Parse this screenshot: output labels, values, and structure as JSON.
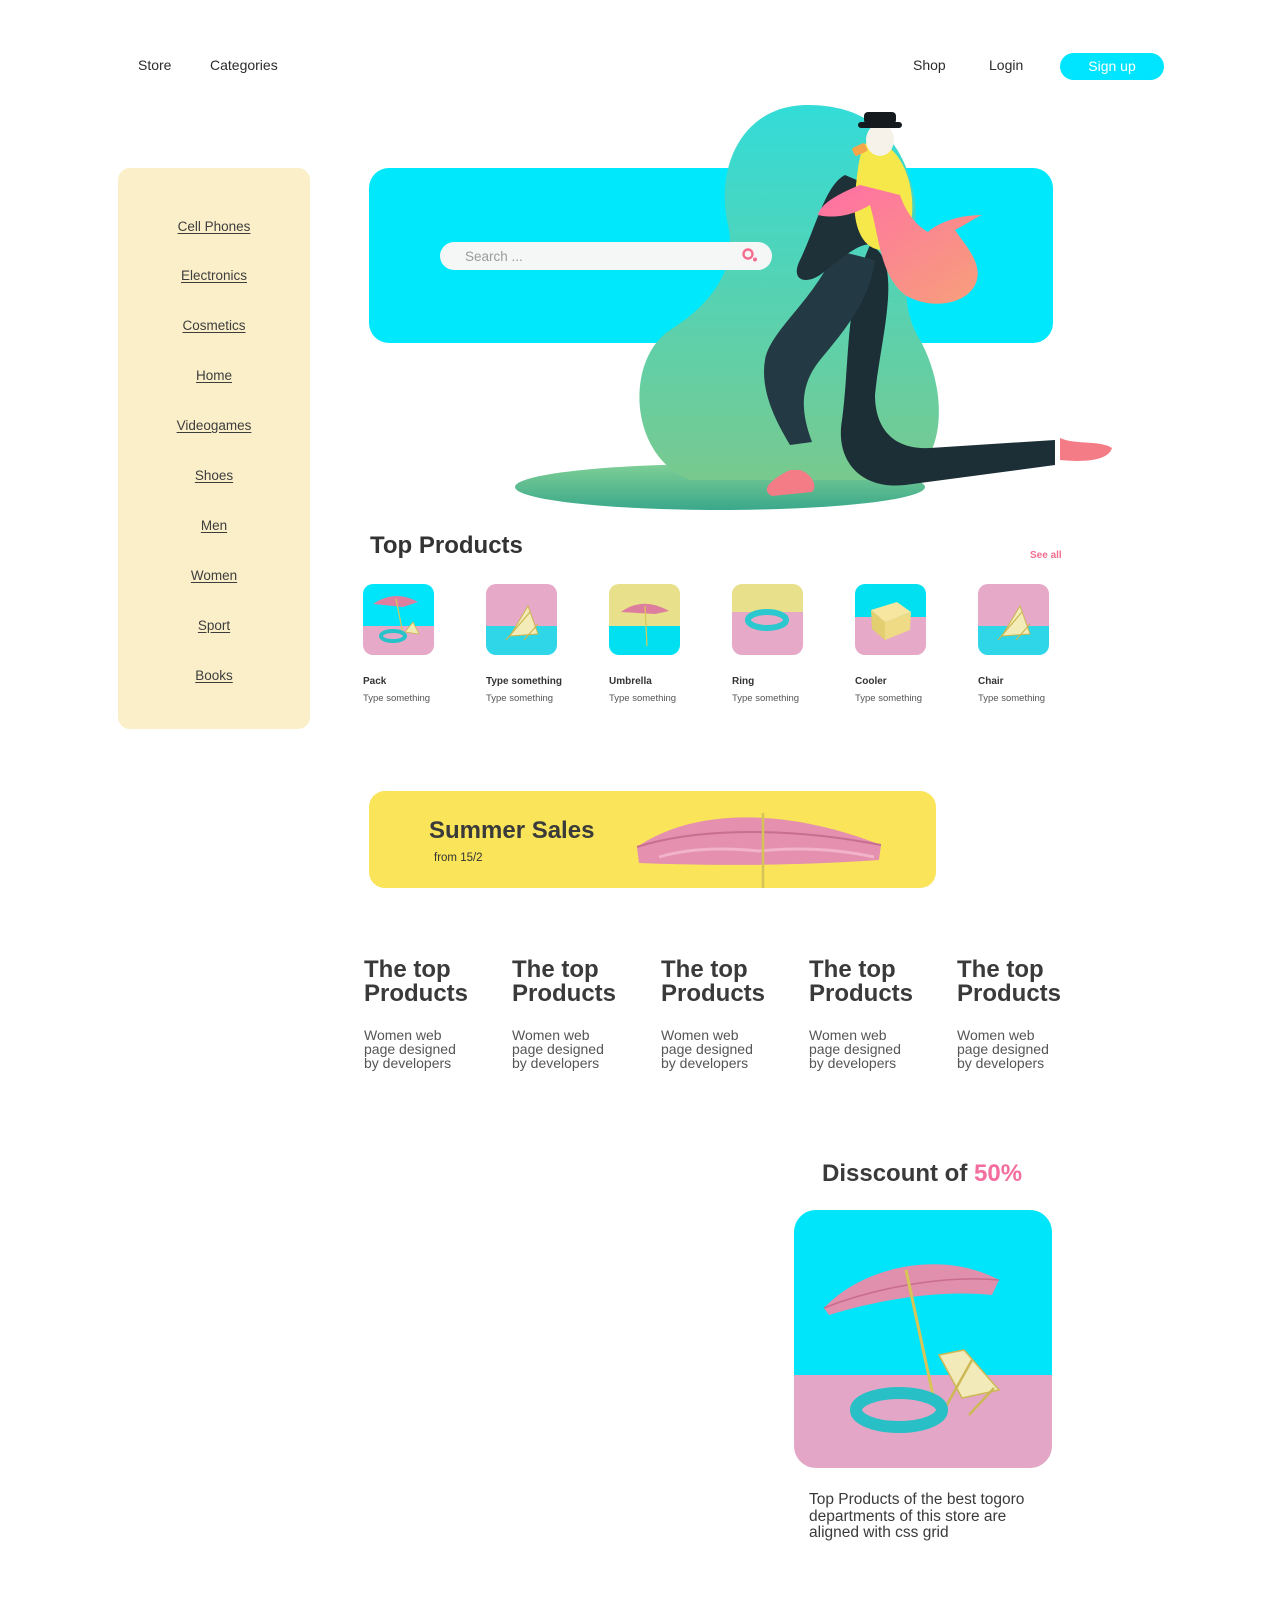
{
  "nav": {
    "store": "Store",
    "categories": "Categories",
    "shop": "Shop",
    "login": "Login",
    "signup": "Sign up"
  },
  "sidebar": {
    "items": [
      {
        "label": "Cell Phones"
      },
      {
        "label": "Electronics"
      },
      {
        "label": "Cosmetics"
      },
      {
        "label": "Home"
      },
      {
        "label": "Videogames"
      },
      {
        "label": "Shoes"
      },
      {
        "label": "Men"
      },
      {
        "label": "Women"
      },
      {
        "label": "Sport"
      },
      {
        "label": "Books"
      }
    ]
  },
  "hero": {
    "search_placeholder": "Search ..."
  },
  "top_products": {
    "title": "Top Products",
    "see_all": "See all",
    "items": [
      {
        "name": "Pack",
        "sub": "Type something"
      },
      {
        "name": "Type something",
        "sub": "Type something"
      },
      {
        "name": "Umbrella",
        "sub": "Type something"
      },
      {
        "name": "Ring",
        "sub": "Type something"
      },
      {
        "name": "Cooler",
        "sub": "Type something"
      },
      {
        "name": "Chair",
        "sub": "Type something"
      }
    ]
  },
  "summer_sales": {
    "title": "Summer Sales",
    "subtitle": "from 15/2"
  },
  "info_columns": [
    {
      "title": "The top Products",
      "text": "Women web page designed by developers"
    },
    {
      "title": "The top Products",
      "text": "Women web page designed by developers"
    },
    {
      "title": "The top Products",
      "text": "Women web page designed by developers"
    },
    {
      "title": "The top Products",
      "text": "Women web page designed by developers"
    },
    {
      "title": "The top Products",
      "text": "Women web page designed by developers"
    }
  ],
  "discount": {
    "title": "Disscount of",
    "percent": "50%",
    "text": "Top Products of the best togoro departments of this store are aligned with css grid"
  },
  "colors": {
    "accent_cyan": "#00e8fc",
    "sidebar_bg": "#faefc9",
    "sales_bg": "#f9e45a",
    "pink": "#f36d9e",
    "thumb_pink": "#e6a9c8",
    "thumb_yellow": "#e8e08a"
  }
}
